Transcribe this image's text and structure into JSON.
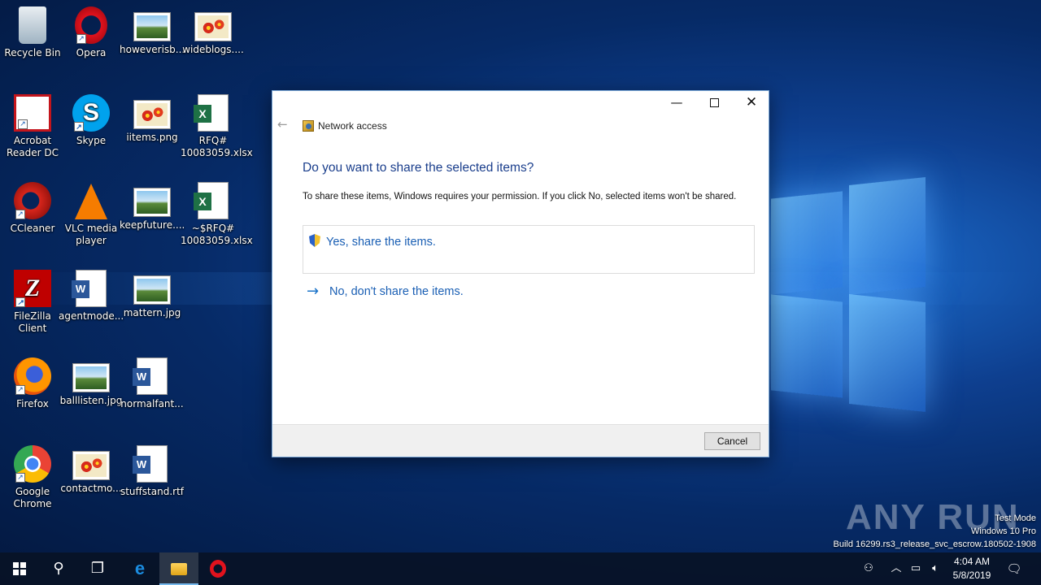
{
  "desktop": {
    "icons": [
      {
        "label": "Recycle Bin"
      },
      {
        "label": "Opera"
      },
      {
        "label": "howeverisb..."
      },
      {
        "label": "wideblogs...."
      },
      {
        "label": "Acrobat Reader DC"
      },
      {
        "label": "Skype"
      },
      {
        "label": "iitems.png"
      },
      {
        "label": "RFQ# 10083059.xlsx"
      },
      {
        "label": "CCleaner"
      },
      {
        "label": "VLC media player"
      },
      {
        "label": "keepfuture...."
      },
      {
        "label": "~$RFQ# 10083059.xlsx"
      },
      {
        "label": "FileZilla Client"
      },
      {
        "label": "agentmode..."
      },
      {
        "label": "mattern.jpg"
      },
      {
        "label": "Firefox"
      },
      {
        "label": "balllisten.jpg"
      },
      {
        "label": "normalfant..."
      },
      {
        "label": "Google Chrome"
      },
      {
        "label": "contactmo..."
      },
      {
        "label": "stuffstand.rtf"
      }
    ]
  },
  "dialog": {
    "nav_title": "Network access",
    "heading": "Do you want to share the selected items?",
    "description": "To share these items, Windows requires your permission. If you click No, selected items won't be shared.",
    "option_yes": "Yes, share the items.",
    "option_no": "No, don't share the items.",
    "cancel_label": "Cancel",
    "window_controls": {
      "minimize": "—",
      "close": "✕"
    }
  },
  "watermark": {
    "brand": "ANY RUN",
    "line1": "Test Mode",
    "line2": "Windows 10 Pro",
    "line3": "Build 16299.rs3_release_svc_escrow.180502-1908"
  },
  "taskbar": {
    "time": "4:04 AM",
    "date": "5/8/2019"
  }
}
